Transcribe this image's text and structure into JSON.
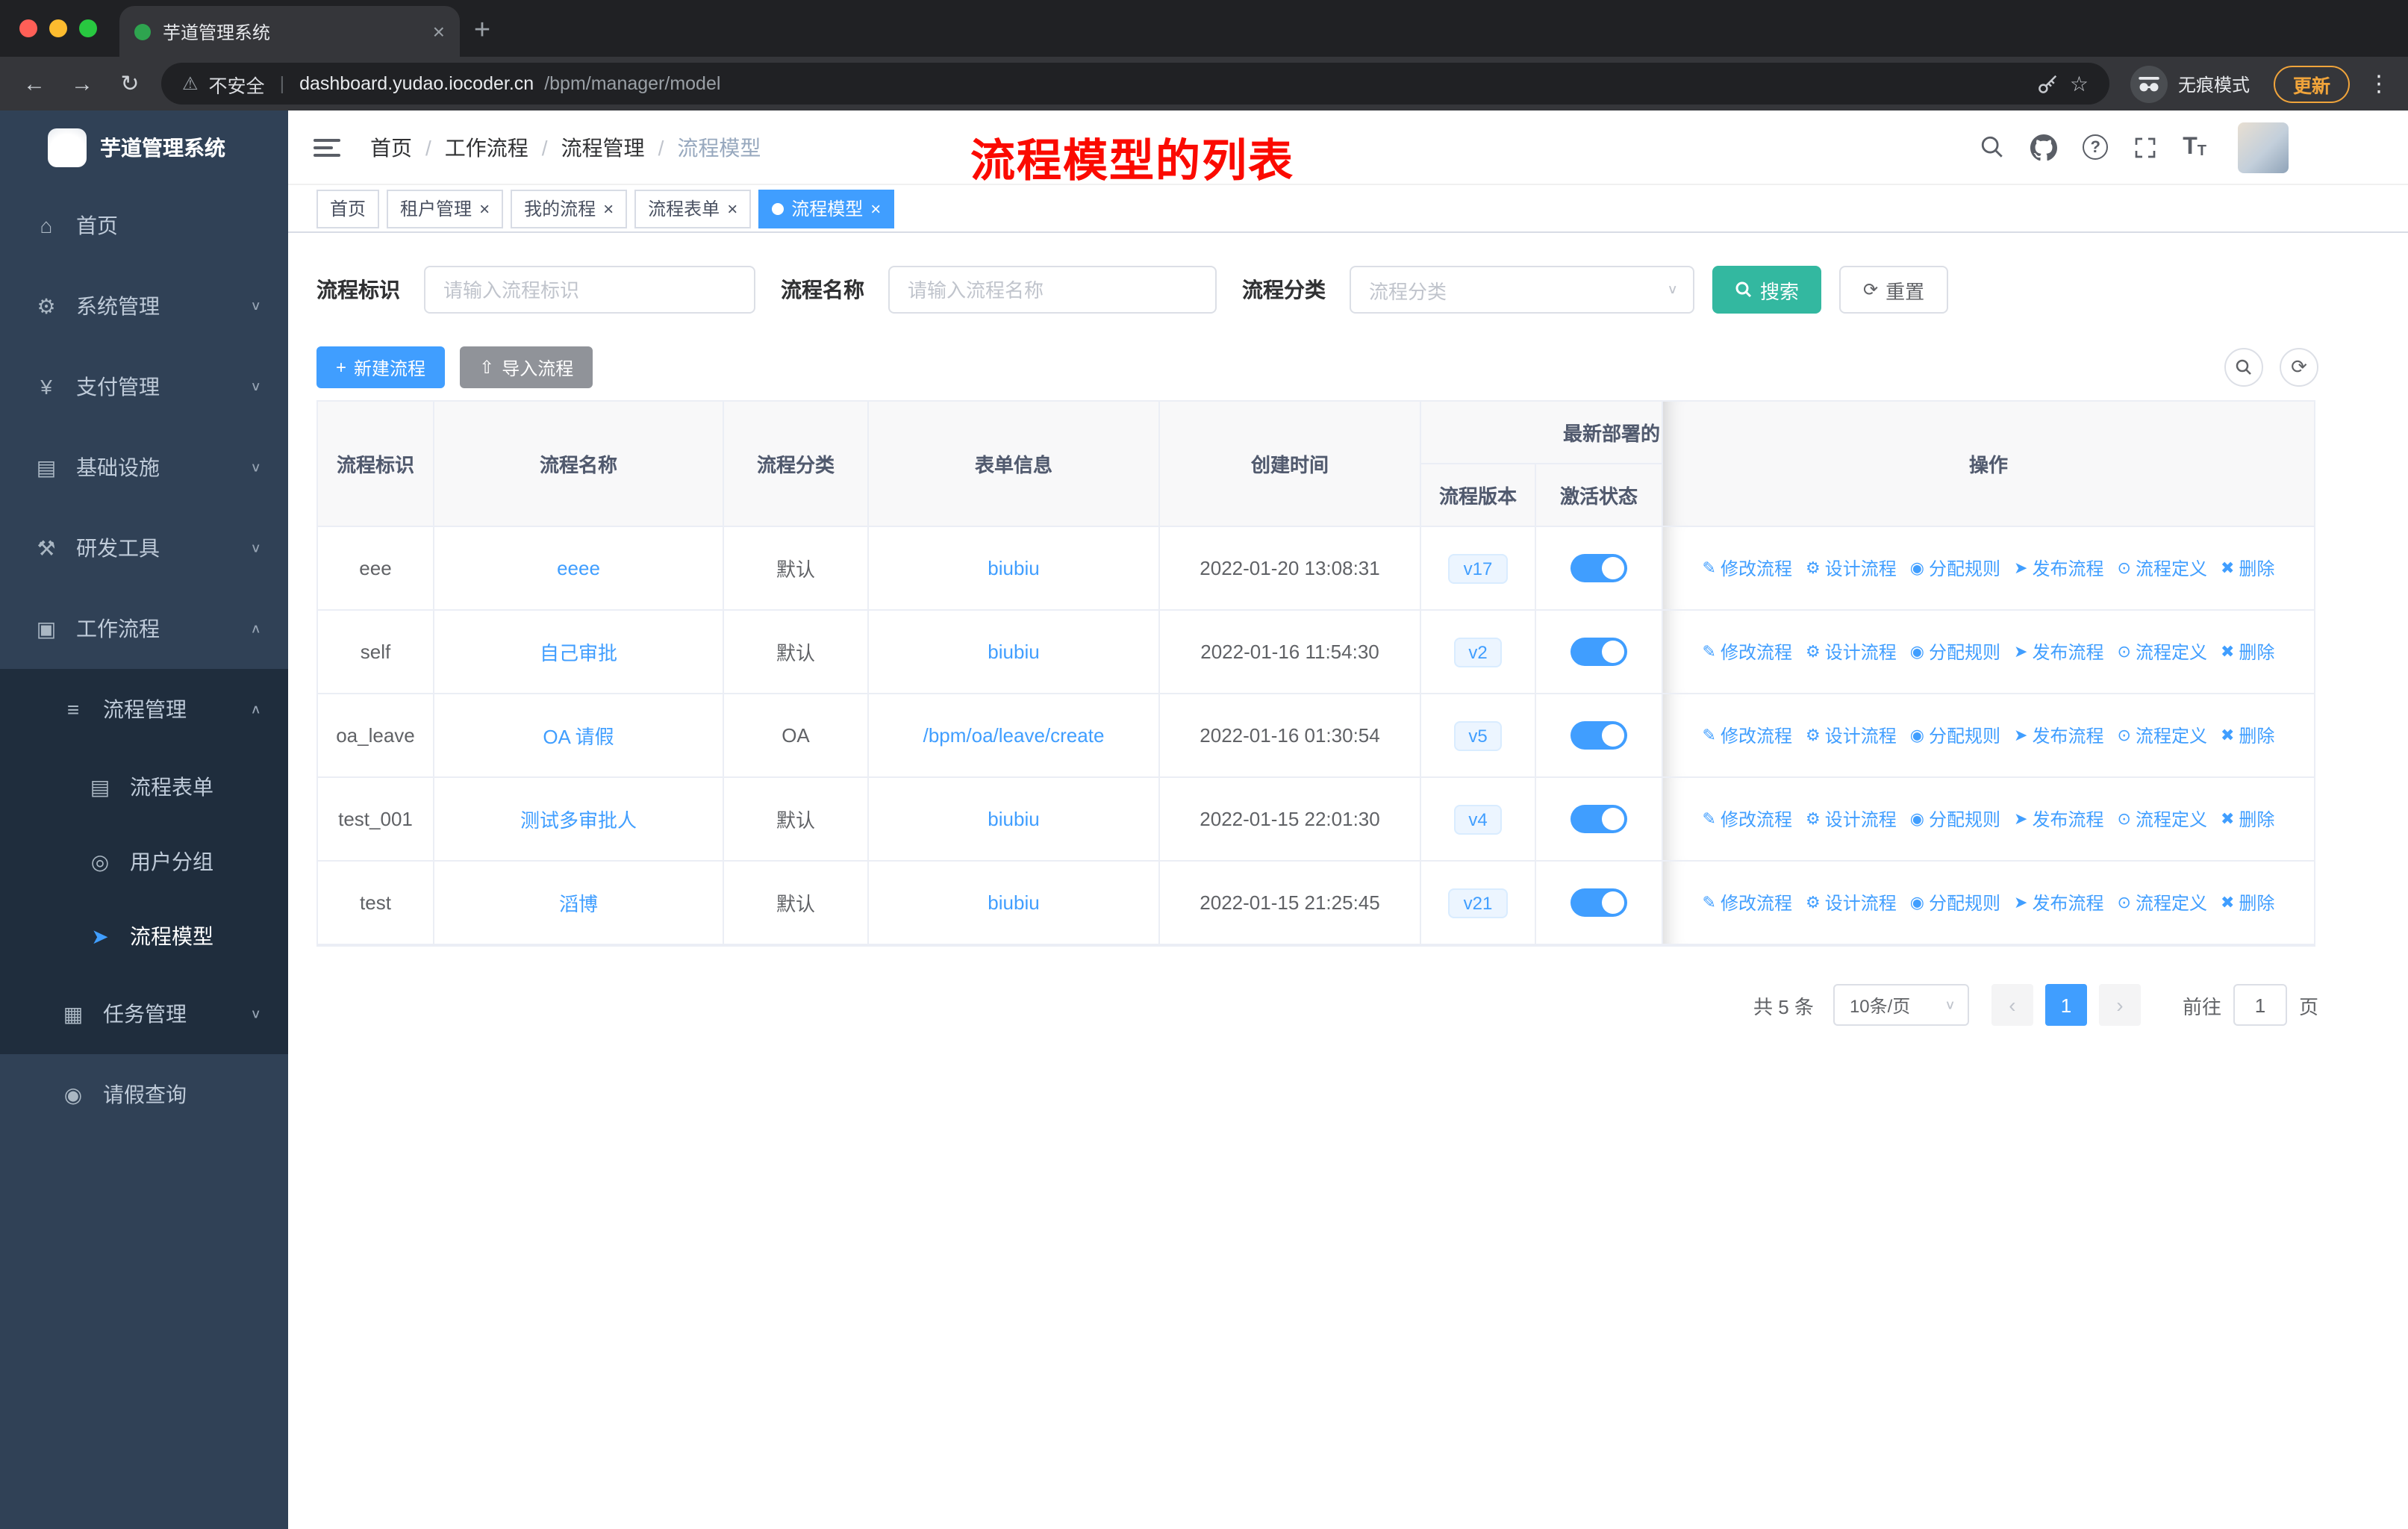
{
  "colors": {
    "primary": "#409eff",
    "search_button": "#33b8a0",
    "import_button": "#909399",
    "sidebar_bg": "#304156",
    "sidebar_sub_bg": "#1f2d3d",
    "annotation_red": "#fb0a00",
    "update_orange": "#f0a43b",
    "badge_bg": "#ecf5ff"
  },
  "icons": {
    "tab_close": "×",
    "new_tab": "+",
    "back": "←",
    "forward": "→",
    "reload": "↻",
    "warning": "⚠",
    "star": "☆",
    "kebab": "⋮",
    "divider": "|",
    "breadcrumb_sep": "/",
    "chevron_down": "∨",
    "chevron_up": "∧",
    "select_arrow": "∨",
    "plus": "+",
    "upload": "⇧",
    "refresh": "⟳",
    "prev": "‹",
    "next": "›",
    "question": "?",
    "text_size_large": "T",
    "text_size_small": "T"
  },
  "browser": {
    "tab": {
      "title": "芋道管理系统"
    },
    "toolbar": {
      "security_label": "不安全",
      "url_host": "dashboard.yudao.iocoder.cn",
      "url_path": "/bpm/manager/model",
      "incognito_label": "无痕模式",
      "update_label": "更新"
    }
  },
  "sidebar": {
    "logo_title": "芋道管理系统",
    "menu": [
      {
        "name": "home",
        "label": "首页",
        "icon": "home-icon",
        "glyph": "⌂",
        "level": 0,
        "sub": false,
        "chevron": null,
        "active": false
      },
      {
        "name": "system-management",
        "label": "系统管理",
        "icon": "gear-icon",
        "glyph": "⚙",
        "level": 0,
        "sub": false,
        "chevron": "down",
        "active": false
      },
      {
        "name": "payment-management",
        "label": "支付管理",
        "icon": "yen-icon",
        "glyph": "¥",
        "level": 0,
        "sub": false,
        "chevron": "down",
        "active": false
      },
      {
        "name": "infrastructure",
        "label": "基础设施",
        "icon": "monitor-icon",
        "glyph": "▤",
        "level": 0,
        "sub": false,
        "chevron": "down",
        "active": false
      },
      {
        "name": "dev-tools",
        "label": "研发工具",
        "icon": "tools-icon",
        "glyph": "⚒",
        "level": 0,
        "sub": false,
        "chevron": "down",
        "active": false
      },
      {
        "name": "workflow",
        "label": "工作流程",
        "icon": "briefcase-icon",
        "glyph": "▣",
        "level": 0,
        "sub": false,
        "chevron": "up",
        "active": false
      },
      {
        "name": "process-management",
        "label": "流程管理",
        "icon": "list-icon",
        "glyph": "≡",
        "level": 1,
        "sub": true,
        "chevron": "up",
        "active": false
      },
      {
        "name": "process-form",
        "label": "流程表单",
        "icon": "document-icon",
        "glyph": "▤",
        "level": 2,
        "sub": true,
        "chevron": null,
        "active": false
      },
      {
        "name": "user-group",
        "label": "用户分组",
        "icon": "users-icon",
        "glyph": "◎",
        "level": 2,
        "sub": true,
        "chevron": null,
        "active": false
      },
      {
        "name": "process-model",
        "label": "流程模型",
        "icon": "paper-plane-icon",
        "glyph": "➤",
        "level": 2,
        "sub": true,
        "chevron": null,
        "active": true
      },
      {
        "name": "task-management",
        "label": "任务管理",
        "icon": "tasks-icon",
        "glyph": "▦",
        "level": 1,
        "sub": true,
        "chevron": "down",
        "active": false
      },
      {
        "name": "leave-query",
        "label": "请假查询",
        "icon": "person-icon",
        "glyph": "◉",
        "level": 1,
        "sub": false,
        "chevron": null,
        "active": false
      }
    ]
  },
  "header": {
    "breadcrumb": [
      "首页",
      "工作流程",
      "流程管理",
      "流程模型"
    ],
    "annotation": "流程模型的列表"
  },
  "tags": [
    {
      "label": "首页",
      "closable": false,
      "active": false
    },
    {
      "label": "租户管理",
      "closable": true,
      "active": false
    },
    {
      "label": "我的流程",
      "closable": true,
      "active": false
    },
    {
      "label": "流程表单",
      "closable": true,
      "active": false
    },
    {
      "label": "流程模型",
      "closable": true,
      "active": true
    }
  ],
  "filters": {
    "key_label": "流程标识",
    "key_placeholder": "请输入流程标识",
    "name_label": "流程名称",
    "name_placeholder": "请输入流程名称",
    "category_label": "流程分类",
    "category_placeholder": "流程分类",
    "search_label": "搜索",
    "reset_label": "重置"
  },
  "toolbar": {
    "create_label": "新建流程",
    "import_label": "导入流程"
  },
  "table": {
    "columns": [
      "流程标识",
      "流程名称",
      "流程分类",
      "表单信息",
      "创建时间"
    ],
    "group_label": "最新部署的",
    "sub_columns": [
      "流程版本",
      "激活状态"
    ],
    "actions_column": "操作",
    "actions": [
      {
        "name": "edit-flow",
        "label": "修改流程",
        "glyph": "✎"
      },
      {
        "name": "design-flow",
        "label": "设计流程",
        "glyph": "⚙"
      },
      {
        "name": "assign-rule",
        "label": "分配规则",
        "glyph": "◉"
      },
      {
        "name": "publish-flow",
        "label": "发布流程",
        "glyph": "➤"
      },
      {
        "name": "flow-definition",
        "label": "流程定义",
        "glyph": "⊙"
      },
      {
        "name": "delete",
        "label": "删除",
        "glyph": "✖"
      }
    ],
    "rows": [
      {
        "key": "eee",
        "name": "eeee",
        "category": "默认",
        "form": "biubiu",
        "created": "2022-01-20 13:08:31",
        "version": "v17",
        "active": true
      },
      {
        "key": "self",
        "name": "自己审批",
        "category": "默认",
        "form": "biubiu",
        "created": "2022-01-16 11:54:30",
        "version": "v2",
        "active": true
      },
      {
        "key": "oa_leave",
        "name": "OA 请假",
        "category": "OA",
        "form": "/bpm/oa/leave/create",
        "created": "2022-01-16 01:30:54",
        "version": "v5",
        "active": true
      },
      {
        "key": "test_001",
        "name": "测试多审批人",
        "category": "默认",
        "form": "biubiu",
        "created": "2022-01-15 22:01:30",
        "version": "v4",
        "active": true
      },
      {
        "key": "test",
        "name": "滔博",
        "category": "默认",
        "form": "biubiu",
        "created": "2022-01-15 21:25:45",
        "version": "v21",
        "active": true
      }
    ]
  },
  "pagination": {
    "total_label": "共 5 条",
    "page_size": "10条/页",
    "current_page": "1",
    "goto_label": "前往",
    "goto_value": "1",
    "page_suffix": "页"
  }
}
